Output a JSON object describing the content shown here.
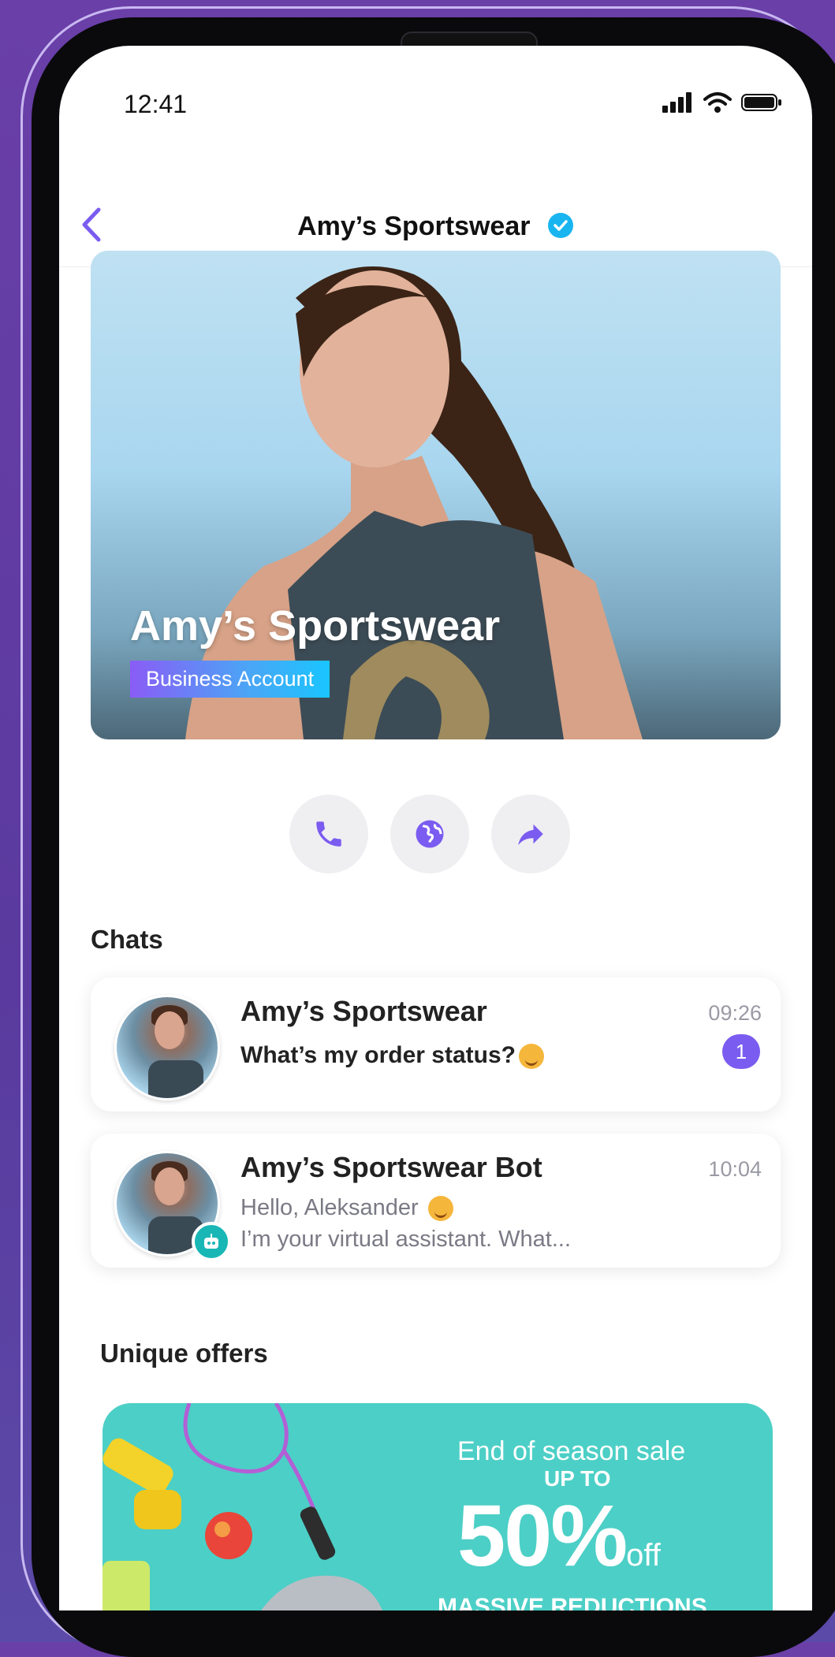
{
  "status_bar": {
    "time": "12:41"
  },
  "header": {
    "title": "Amy’s Sportswear"
  },
  "hero": {
    "title": "Amy’s Sportswear",
    "badge": "Business Account"
  },
  "actions": [
    {
      "icon": "phone-icon"
    },
    {
      "icon": "globe-icon"
    },
    {
      "icon": "share-icon"
    }
  ],
  "chats_section": {
    "title": "Chats",
    "items": [
      {
        "name": "Amy’s Sportswear",
        "time": "09:26",
        "message": "What’s my order status?",
        "unread": "1"
      },
      {
        "name": "Amy’s Sportswear Bot",
        "time": "10:04",
        "line1": "Hello, Aleksander",
        "line2": "I’m your virtual assistant. What..."
      }
    ]
  },
  "offers_section": {
    "title": "Unique offers",
    "offer": {
      "line1": "End of season sale",
      "line2": "UP TO",
      "big": "50%",
      "off": "off",
      "line3": "MASSIVE REDUCTIONS"
    }
  },
  "colors": {
    "accent": "#7b5cf0",
    "background": "#5a3a9e",
    "offer_bg": "#4ccfc6",
    "verified": "#19b5f0"
  }
}
